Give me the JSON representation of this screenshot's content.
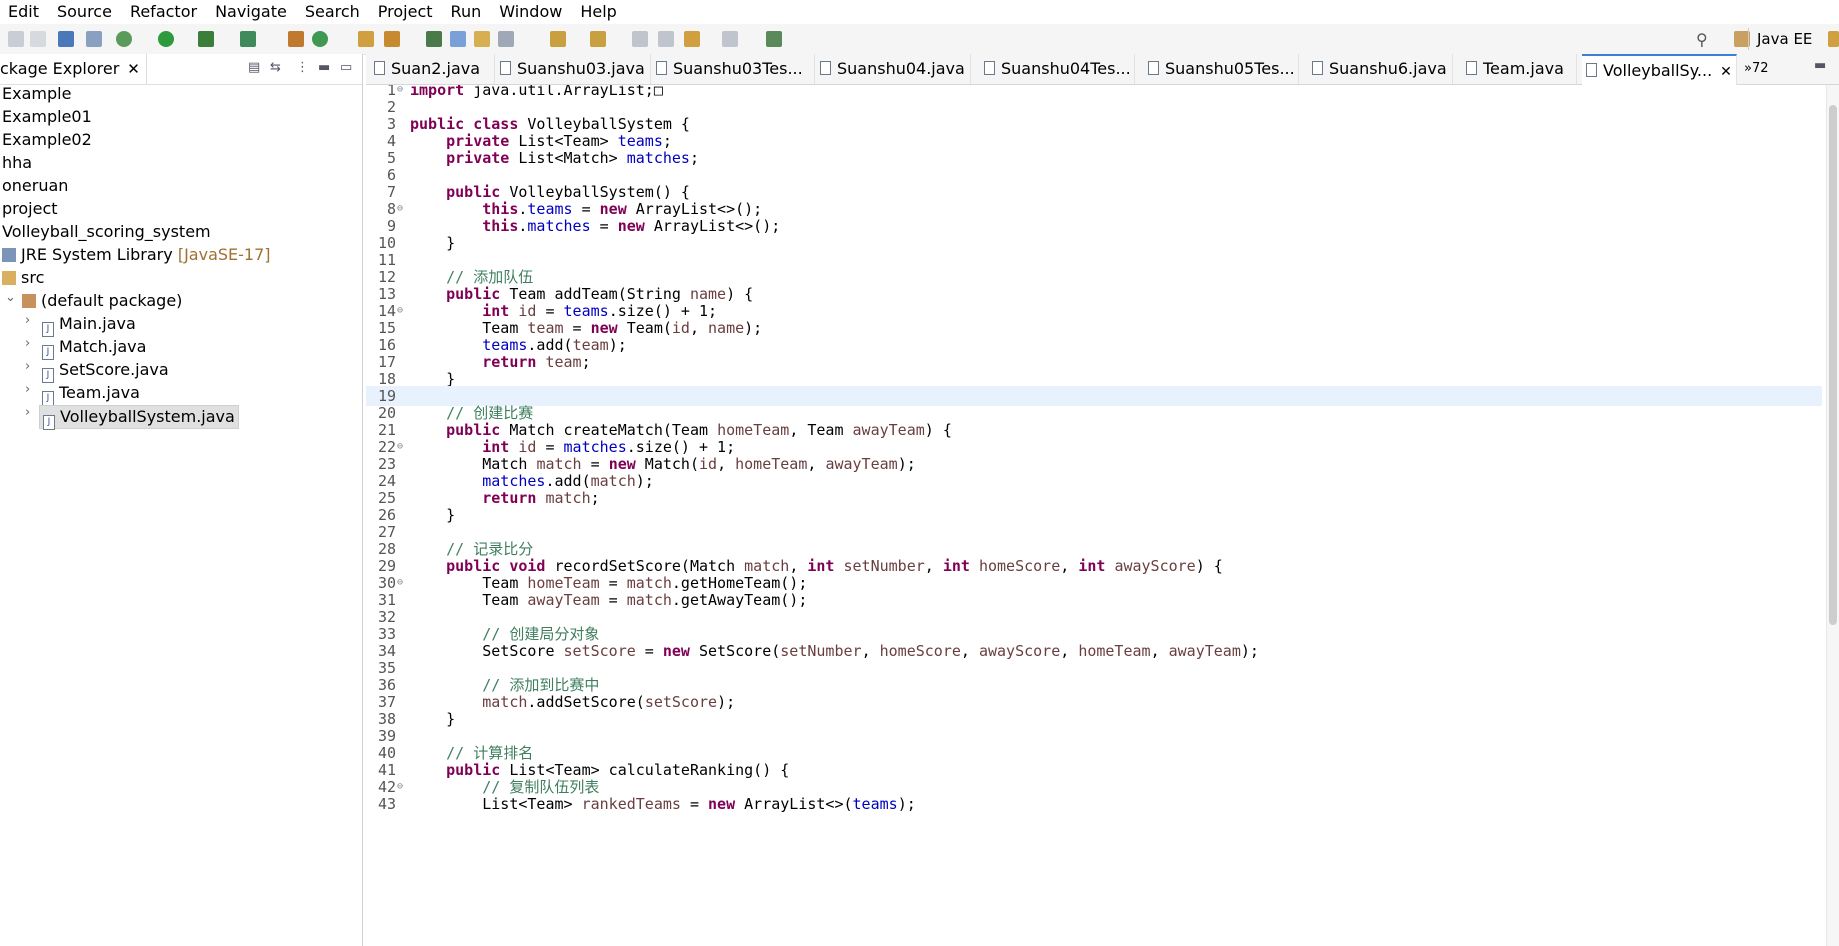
{
  "menu": [
    "Edit",
    "Source",
    "Refactor",
    "Navigate",
    "Search",
    "Project",
    "Run",
    "Window",
    "Help"
  ],
  "toolbar": {
    "perspective": "Java EE"
  },
  "explorer": {
    "title": "ckage Explorer",
    "items": [
      {
        "label": "Example"
      },
      {
        "label": "Example01"
      },
      {
        "label": "Example02"
      },
      {
        "label": "hha"
      },
      {
        "label": "oneruan"
      },
      {
        "label": "project"
      },
      {
        "label": "Volleyball_scoring_system"
      },
      {
        "label": "JRE System Library",
        "decoration": "[JavaSE-17]"
      },
      {
        "label": "src"
      },
      {
        "label": "(default package)"
      },
      {
        "label": "Main.java"
      },
      {
        "label": "Match.java"
      },
      {
        "label": "SetScore.java"
      },
      {
        "label": "Team.java"
      },
      {
        "label": "VolleyballSystem.java"
      }
    ]
  },
  "tabs": [
    {
      "label": "Suan2.java"
    },
    {
      "label": "Suanshu03.java"
    },
    {
      "label": "Suanshu03Tes..."
    },
    {
      "label": "Suanshu04.java"
    },
    {
      "label": "Suanshu04Tes..."
    },
    {
      "label": "Suanshu05Tes..."
    },
    {
      "label": "Suanshu6.java"
    },
    {
      "label": "Team.java"
    },
    {
      "label": "VolleyballSy..."
    }
  ],
  "tabs_overflow": "»72",
  "editor": {
    "current_line": 19,
    "lines": [
      "import java.util.ArrayList;□",
      "",
      "public class VolleyballSystem {",
      "    private List<Team> teams;",
      "    private List<Match> matches;",
      "",
      "    public VolleyballSystem() {",
      "        this.teams = new ArrayList<>();",
      "        this.matches = new ArrayList<>();",
      "    }",
      "",
      "    // 添加队伍",
      "    public Team addTeam(String name) {",
      "        int id = teams.size() + 1;",
      "        Team team = new Team(id, name);",
      "        teams.add(team);",
      "        return team;",
      "    }",
      "",
      "    // 创建比赛",
      "    public Match createMatch(Team homeTeam, Team awayTeam) {",
      "        int id = matches.size() + 1;",
      "        Match match = new Match(id, homeTeam, awayTeam);",
      "        matches.add(match);",
      "        return match;",
      "    }",
      "",
      "    // 记录比分",
      "    public void recordSetScore(Match match, int setNumber, int homeScore, int awayScore) {",
      "        Team homeTeam = match.getHomeTeam();",
      "        Team awayTeam = match.getAwayTeam();",
      "",
      "        // 创建局分对象",
      "        SetScore setScore = new SetScore(setNumber, homeScore, awayScore, homeTeam, awayTeam);",
      "",
      "        // 添加到比赛中",
      "        match.addSetScore(setScore);",
      "    }",
      "",
      "    // 计算排名",
      "    public List<Team> calculateRanking() {",
      "        // 复制队伍列表",
      "        List<Team> rankedTeams = new ArrayList<>(teams);"
    ]
  }
}
